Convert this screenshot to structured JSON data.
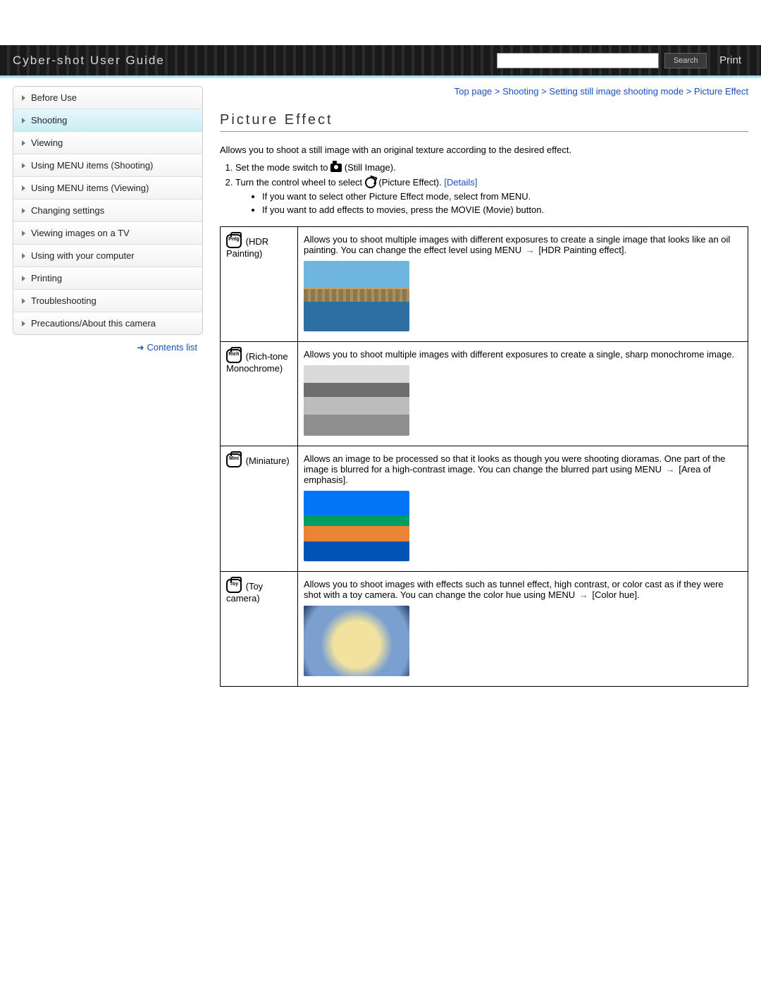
{
  "header": {
    "site_title": "Cyber-shot User Guide",
    "search_label": "Search",
    "print_label": "Print",
    "search_placeholder": ""
  },
  "sidebar": {
    "items": [
      {
        "label": "Before Use",
        "active": false
      },
      {
        "label": "Shooting",
        "active": true
      },
      {
        "label": "Viewing",
        "active": false
      },
      {
        "label": "Using MENU items (Shooting)",
        "active": false
      },
      {
        "label": "Using MENU items (Viewing)",
        "active": false
      },
      {
        "label": "Changing settings",
        "active": false
      },
      {
        "label": "Viewing images on a TV",
        "active": false
      },
      {
        "label": "Using with your computer",
        "active": false
      },
      {
        "label": "Printing",
        "active": false
      },
      {
        "label": "Troubleshooting",
        "active": false
      },
      {
        "label": "Precautions/About this camera",
        "active": false
      }
    ],
    "contents_link": "Contents list"
  },
  "breadcrumb": {
    "parts": [
      "Top page",
      "Shooting",
      "Setting still image shooting mode",
      "Picture Effect"
    ],
    "sep": ">"
  },
  "page": {
    "title": "Picture Effect",
    "intro": "Allows you to shoot a still image with an original texture according to the desired effect.",
    "step1_a": "Set the mode switch to ",
    "step1_b": " (Still Image).",
    "step2_a": "Turn the control wheel to select ",
    "step2_b": " (Picture Effect). ",
    "details_link": "[Details]",
    "sub1": "If you want to select other Picture Effect mode, select from MENU.",
    "sub2": "If you want to add effects to movies, press the MOVIE (Movie) button.",
    "arrow": "→"
  },
  "effects": [
    {
      "icon_label": "Pntg",
      "name": " (HDR Painting)",
      "desc_a": "Allows you to shoot multiple images with different exposures to create a single image that looks like an oil painting. You can change the effect level using MENU ",
      "desc_b": " [HDR Painting effect].",
      "sample": "hdr"
    },
    {
      "icon_label": "Rich",
      "name": " (Rich-tone Monochrome)",
      "desc_a": "Allows you to shoot multiple images with different exposures to create a single, sharp monochrome image.",
      "desc_b": "",
      "sample": "mono"
    },
    {
      "icon_label": "Mini",
      "name": " (Miniature)",
      "desc_a": "Allows an image to be processed so that it looks as though you were shooting dioramas. One part of the image is blurred for a high-contrast image. You can change the blurred part using MENU ",
      "desc_b": " [Area of emphasis].",
      "sample": "mini"
    },
    {
      "icon_label": "Toy",
      "name": " (Toy camera)",
      "desc_a": "Allows you to shoot images with effects such as tunnel effect, high contrast, or color cast as if they were shot with a toy camera. You can change the color hue using MENU ",
      "desc_b": " [Color hue].",
      "sample": "toy"
    }
  ]
}
